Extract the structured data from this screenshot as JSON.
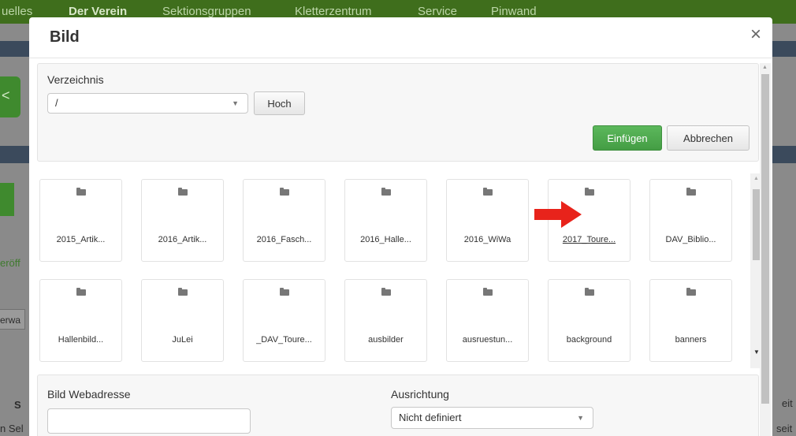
{
  "background": {
    "nav": [
      "uelles",
      "Der Verein",
      "Sektionsgruppen",
      "Kletterzentrum",
      "Service",
      "Pinwand"
    ],
    "left_fragments": {
      "publish": "eröff",
      "search": "erwa",
      "s_frag": "S",
      "sel": "n Sel"
    },
    "right_fragments": {
      "eit": "eit",
      "seit": "seit"
    },
    "green_button": "<"
  },
  "modal": {
    "title": "Bild",
    "close_icon": "×",
    "directory": {
      "label": "Verzeichnis",
      "selected": "/",
      "up_label": "Hoch"
    },
    "insert_label": "Einfügen",
    "cancel_label": "Abbrechen",
    "folders": [
      {
        "name": "2015_Artik...",
        "link": false
      },
      {
        "name": "2016_Artik...",
        "link": false
      },
      {
        "name": "2016_Fasch...",
        "link": false
      },
      {
        "name": "2016_Halle...",
        "link": false
      },
      {
        "name": "2016_WiWa",
        "link": false
      },
      {
        "name": "2017_Toure...",
        "link": true
      },
      {
        "name": "DAV_Biblio...",
        "link": false
      },
      {
        "name": "Hallenbild...",
        "link": false
      },
      {
        "name": "JuLei",
        "link": false
      },
      {
        "name": "_DAV_Toure...",
        "link": false
      },
      {
        "name": "ausbilder",
        "link": false
      },
      {
        "name": "ausruestun...",
        "link": false
      },
      {
        "name": "background",
        "link": false
      },
      {
        "name": "banners",
        "link": false
      }
    ],
    "url": {
      "label": "Bild Webadresse",
      "value": ""
    },
    "alignment": {
      "label": "Ausrichtung",
      "selected": "Nicht definiert"
    }
  },
  "colors": {
    "accent_green": "#5cb85c",
    "arrow_red": "#e8231b",
    "nav_green": "#3f6e1c"
  }
}
